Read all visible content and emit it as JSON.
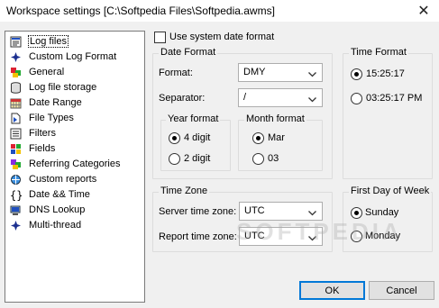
{
  "window": {
    "title": "Workspace settings [C:\\Softpedia Files\\Softpedia.awms]",
    "close_glyph": "✕"
  },
  "sidebar": {
    "items": [
      {
        "label": "Log files",
        "icon": "log-files-icon",
        "selected": true
      },
      {
        "label": "Custom Log Format",
        "icon": "custom-log-format-icon"
      },
      {
        "label": "General",
        "icon": "general-icon"
      },
      {
        "label": "Log file storage",
        "icon": "database-icon"
      },
      {
        "label": "Date Range",
        "icon": "calendar-icon"
      },
      {
        "label": "File Types",
        "icon": "file-types-icon"
      },
      {
        "label": "Filters",
        "icon": "filters-icon"
      },
      {
        "label": "Fields",
        "icon": "fields-icon"
      },
      {
        "label": "Referring Categories",
        "icon": "referring-categories-icon"
      },
      {
        "label": "Custom reports",
        "icon": "custom-reports-icon"
      },
      {
        "label": "Date && Time",
        "icon": "braces-icon"
      },
      {
        "label": "DNS Lookup",
        "icon": "dns-lookup-icon"
      },
      {
        "label": "Multi-thread",
        "icon": "multi-thread-icon"
      }
    ]
  },
  "system_date": {
    "label": "Use system date format",
    "checked": false
  },
  "date_format": {
    "title": "Date Format",
    "format_label": "Format:",
    "format_value": "DMY",
    "separator_label": "Separator:",
    "separator_value": "/",
    "year_format": {
      "title": "Year format",
      "opt4": "4 digit",
      "opt2": "2 digit",
      "selected": "4 digit"
    },
    "month_format": {
      "title": "Month format",
      "opt_mar": "Mar",
      "opt_03": "03",
      "selected": "Mar"
    }
  },
  "time_format": {
    "title": "Time Format",
    "opt24": "15:25:17",
    "opt12": "03:25:17 PM",
    "selected": "15:25:17"
  },
  "time_zone": {
    "title": "Time Zone",
    "server_label": "Server time zone:",
    "server_value": "UTC",
    "report_label": "Report time zone:",
    "report_value": "UTC"
  },
  "first_day": {
    "title": "First Day of Week",
    "opt_sunday": "Sunday",
    "opt_monday": "Monday",
    "selected": "Sunday"
  },
  "buttons": {
    "ok": "OK",
    "cancel": "Cancel"
  },
  "watermark": "SOFTPEDIA"
}
